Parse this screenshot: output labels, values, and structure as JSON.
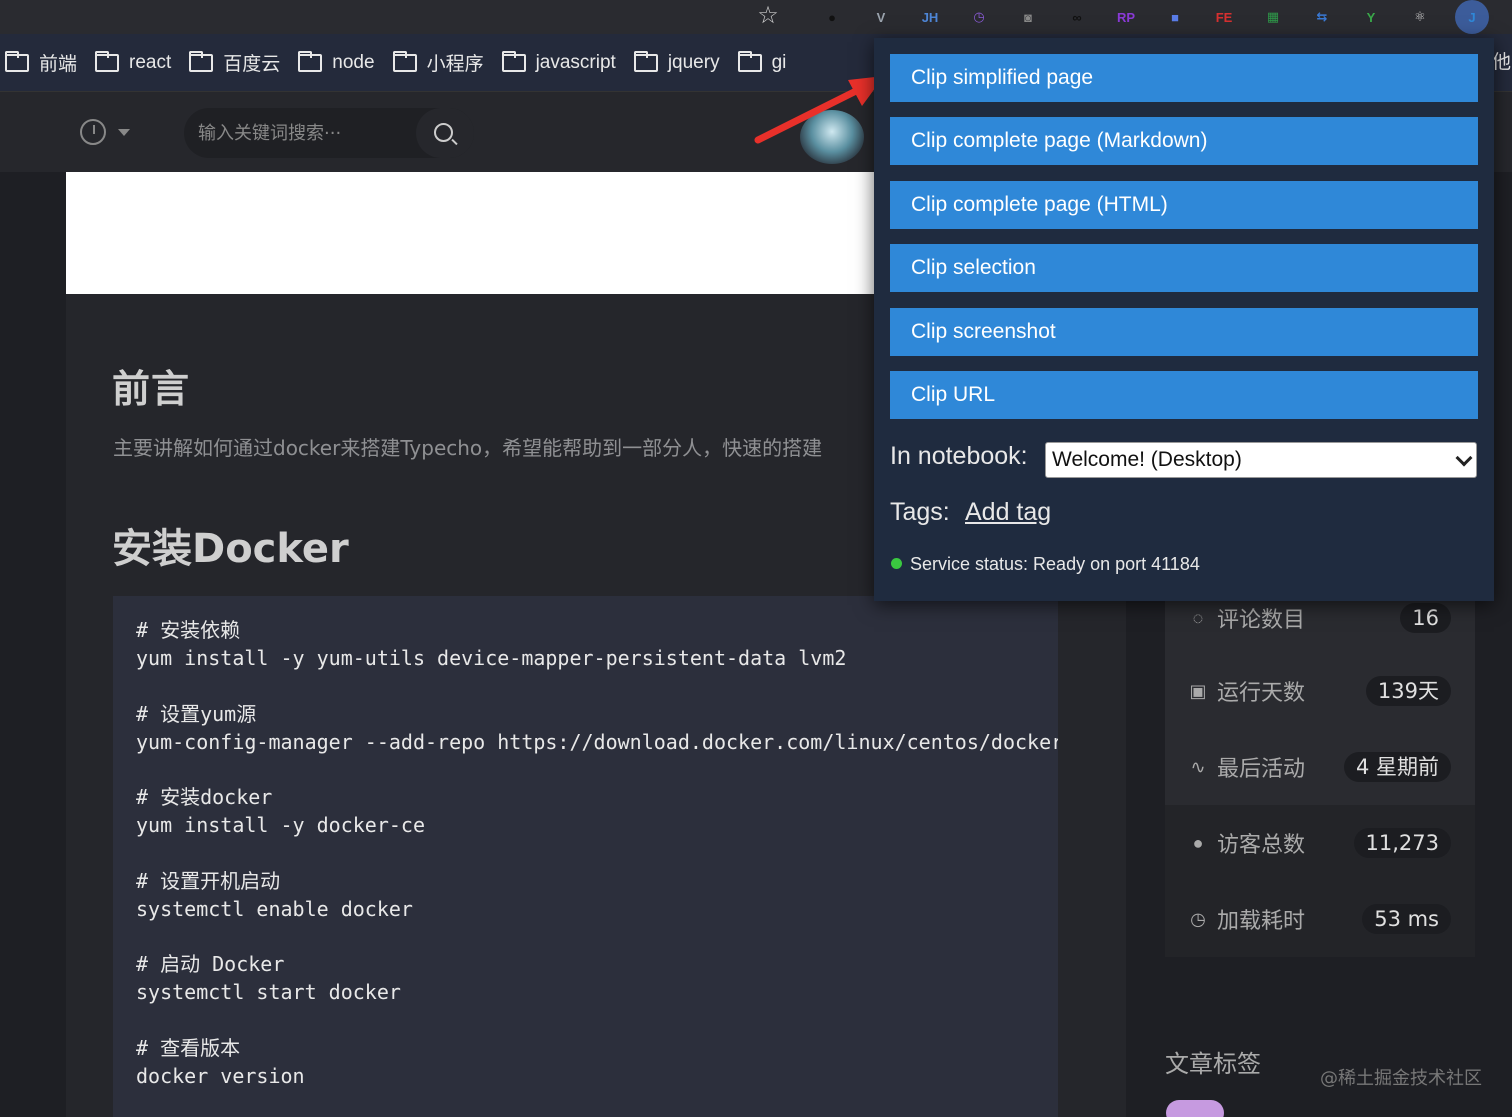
{
  "extensions": {
    "star": "☆",
    "icons": [
      {
        "name": "circle-extension-icon",
        "glyph": "●",
        "color": "#111"
      },
      {
        "name": "vue-devtools-icon",
        "glyph": "V",
        "color": "#9aa3ad"
      },
      {
        "name": "jh-extension-icon",
        "glyph": "JH",
        "color": "#4e86d6"
      },
      {
        "name": "clock-extension-icon",
        "glyph": "◷",
        "color": "#8a5bd6"
      },
      {
        "name": "camera-extension-icon",
        "glyph": "◙",
        "color": "#8a8a8a"
      },
      {
        "name": "infinity-extension-icon",
        "glyph": "∞",
        "color": "#111"
      },
      {
        "name": "rp-extension-icon",
        "glyph": "RP",
        "color": "#8a3ad6"
      },
      {
        "name": "square-extension-icon",
        "glyph": "■",
        "color": "#5a7de8"
      },
      {
        "name": "fe-extension-icon",
        "glyph": "FE",
        "color": "#d63030"
      },
      {
        "name": "sheet-extension-icon",
        "glyph": "▦",
        "color": "#2f9a4a"
      },
      {
        "name": "repeat-extension-icon",
        "glyph": "⇆",
        "color": "#3a7ad6"
      },
      {
        "name": "yandex-extension-icon",
        "glyph": "Y",
        "color": "#3aa84a"
      },
      {
        "name": "react-devtools-icon",
        "glyph": "⚛",
        "color": "#ccc"
      },
      {
        "name": "joplin-extension-icon",
        "glyph": "J",
        "color": "#2f88d8"
      }
    ]
  },
  "bookmarks": [
    "前端",
    "react",
    "百度云",
    "node",
    "小程序",
    "javascript",
    "jquery",
    "gi"
  ],
  "bookmarks_other": "他",
  "header": {
    "search_placeholder": "输入关键词搜索···"
  },
  "article": {
    "heading_foreword": "前言",
    "intro": "主要讲解如何通过docker来搭建Typecho，希望能帮助到一部分人，快速的搭建",
    "heading_docker": "安装Docker",
    "code_groups": [
      [
        "# 安装依赖",
        "yum install -y yum-utils device-mapper-persistent-data lvm2"
      ],
      [
        "# 设置yum源",
        "yum-config-manager --add-repo https://download.docker.com/linux/centos/docker-ce.repo"
      ],
      [
        "# 安装docker",
        "yum install -y docker-ce"
      ],
      [
        "# 设置开机启动",
        "systemctl enable docker"
      ],
      [
        "# 启动 Docker",
        "systemctl start docker"
      ],
      [
        "# 查看版本",
        "docker version"
      ]
    ]
  },
  "sidebar": {
    "stats": [
      {
        "icon": "comment-icon",
        "glyph": "◌",
        "label": "评论数目",
        "value": "16"
      },
      {
        "icon": "calendar-icon",
        "glyph": "▣",
        "label": "运行天数",
        "value": "139天"
      },
      {
        "icon": "activity-icon",
        "glyph": "∿",
        "label": "最后活动",
        "value": "4 星期前"
      },
      {
        "icon": "user-icon",
        "glyph": "●",
        "label": "访客总数",
        "value": "11,273"
      },
      {
        "icon": "timer-icon",
        "glyph": "◷",
        "label": "加载耗时",
        "value": "53 ms"
      }
    ],
    "tags_heading": "文章标签",
    "watermark": "@稀土掘金技术社区"
  },
  "clipper": {
    "buttons": [
      "Clip simplified page",
      "Clip complete page (Markdown)",
      "Clip complete page (HTML)",
      "Clip selection",
      "Clip screenshot",
      "Clip URL"
    ],
    "notebook_label": "In notebook:",
    "notebook_value": "Welcome! (Desktop)",
    "tags_label": "Tags:",
    "add_tag": "Add tag",
    "status": "Service status: Ready on port 41184"
  },
  "colors": {
    "accent": "#2f88d8",
    "popup_bg": "#1f2b3f",
    "arrow": "#e8302a",
    "status_ok": "#3ac840"
  }
}
